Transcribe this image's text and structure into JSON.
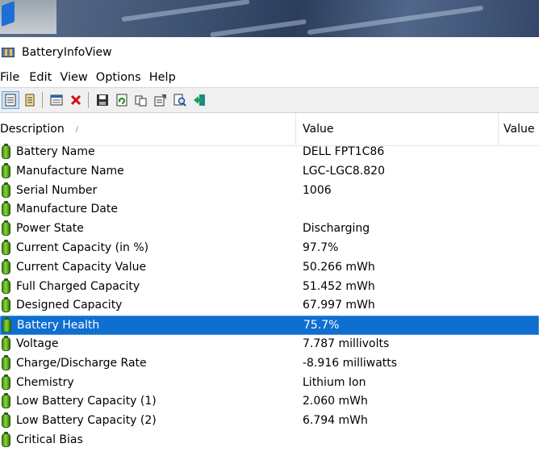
{
  "window": {
    "title": "BatteryInfoView"
  },
  "menu": [
    "File",
    "Edit",
    "View",
    "Options",
    "Help"
  ],
  "toolbar": {
    "buttons": [
      "html-report-icon",
      "text-report-icon",
      "properties-window-icon",
      "delete-icon",
      "save-icon",
      "refresh-icon",
      "copy-icon",
      "options-icon",
      "find-icon",
      "exit-icon"
    ]
  },
  "list": {
    "columns": [
      "Description",
      "Value",
      "Value"
    ],
    "selected_index": 9,
    "rows": [
      {
        "desc": "Battery Name",
        "value": "DELL FPT1C86"
      },
      {
        "desc": "Manufacture Name",
        "value": "LGC-LGC8.820"
      },
      {
        "desc": "Serial Number",
        "value": "1006"
      },
      {
        "desc": "Manufacture Date",
        "value": ""
      },
      {
        "desc": "Power State",
        "value": "Discharging"
      },
      {
        "desc": "Current Capacity (in %)",
        "value": "97.7%"
      },
      {
        "desc": "Current Capacity Value",
        "value": "50.266 mWh"
      },
      {
        "desc": "Full Charged Capacity",
        "value": "51.452 mWh"
      },
      {
        "desc": "Designed Capacity",
        "value": "67.997 mWh"
      },
      {
        "desc": "Battery Health",
        "value": "75.7%"
      },
      {
        "desc": "Voltage",
        "value": "7.787 millivolts"
      },
      {
        "desc": "Charge/Discharge Rate",
        "value": "-8.916 milliwatts"
      },
      {
        "desc": "Chemistry",
        "value": "Lithium Ion"
      },
      {
        "desc": "Low Battery Capacity (1)",
        "value": "2.060 mWh"
      },
      {
        "desc": "Low Battery Capacity (2)",
        "value": "6.794 mWh"
      },
      {
        "desc": "Critical Bias",
        "value": ""
      }
    ]
  },
  "colors": {
    "selection": "#0e6fd1",
    "battery_green": "#5aa61e"
  }
}
